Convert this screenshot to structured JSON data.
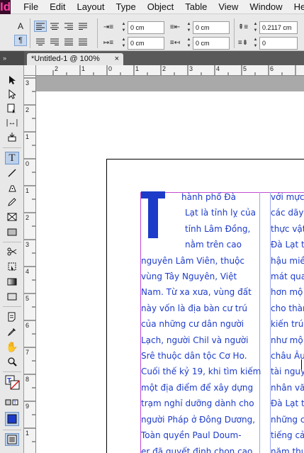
{
  "app": {
    "logo": "Id"
  },
  "menu": [
    "File",
    "Edit",
    "Layout",
    "Type",
    "Object",
    "Table",
    "View",
    "Window",
    "He"
  ],
  "control_panel": {
    "left_indent": "0 cm",
    "right_indent": "0 cm",
    "first_line_indent": "0 cm",
    "last_line_indent": "0 cm",
    "space_before": "0.2117 cm",
    "space_after": "0",
    "char_a_label": "A",
    "para_label": "¶"
  },
  "document_tab": {
    "title": "*Untitled-1 @ 100%",
    "close": "×"
  },
  "toolbox": {
    "collapse": "»"
  },
  "rulers": {
    "horizontal": [
      "2",
      "1",
      "0",
      "1",
      "2",
      "3",
      "4",
      "5",
      "6"
    ],
    "vertical": [
      "3",
      "2",
      "1",
      "0",
      "1",
      "2",
      "3",
      "4",
      "5",
      "6",
      "7",
      "8",
      "9",
      "1"
    ]
  },
  "text": {
    "dropcap": "T",
    "column1": [
      "hành phố Đà",
      "Lạt là tỉnh lỵ của",
      "tỉnh Lâm Đồng,",
      "nằm trên cao",
      "nguyên Lâm Viên, thuộc",
      "vùng Tây Nguyên, Việt",
      "Nam. Từ xa xưa, vùng đất",
      "này vốn là địa bàn cư trú",
      "của những cư dân người",
      "Lạch, người Chil và người",
      "Srê thuộc dân tộc Cơ Ho.",
      "Cuối thế kỷ 19, khi tìm kiếm",
      "một địa điểm để xây dựng",
      "trạm nghỉ dưỡng dành cho",
      "người Pháp ở Đông Dương,",
      "Toàn quyền Paul Doum-",
      "er đã quyết định chọn cao"
    ],
    "column2": [
      "với mực",
      "các dãy",
      "thực vật",
      "Đà Lạt t",
      "hậu miề",
      "mát qua",
      "hơn mộ",
      "cho thàn",
      "kiến trúc",
      "như mộ",
      "châu Âu",
      "tài nguy",
      "nhân vă",
      "Đà Lạt t",
      "những c",
      "tiếng cả",
      "năm thu"
    ]
  }
}
